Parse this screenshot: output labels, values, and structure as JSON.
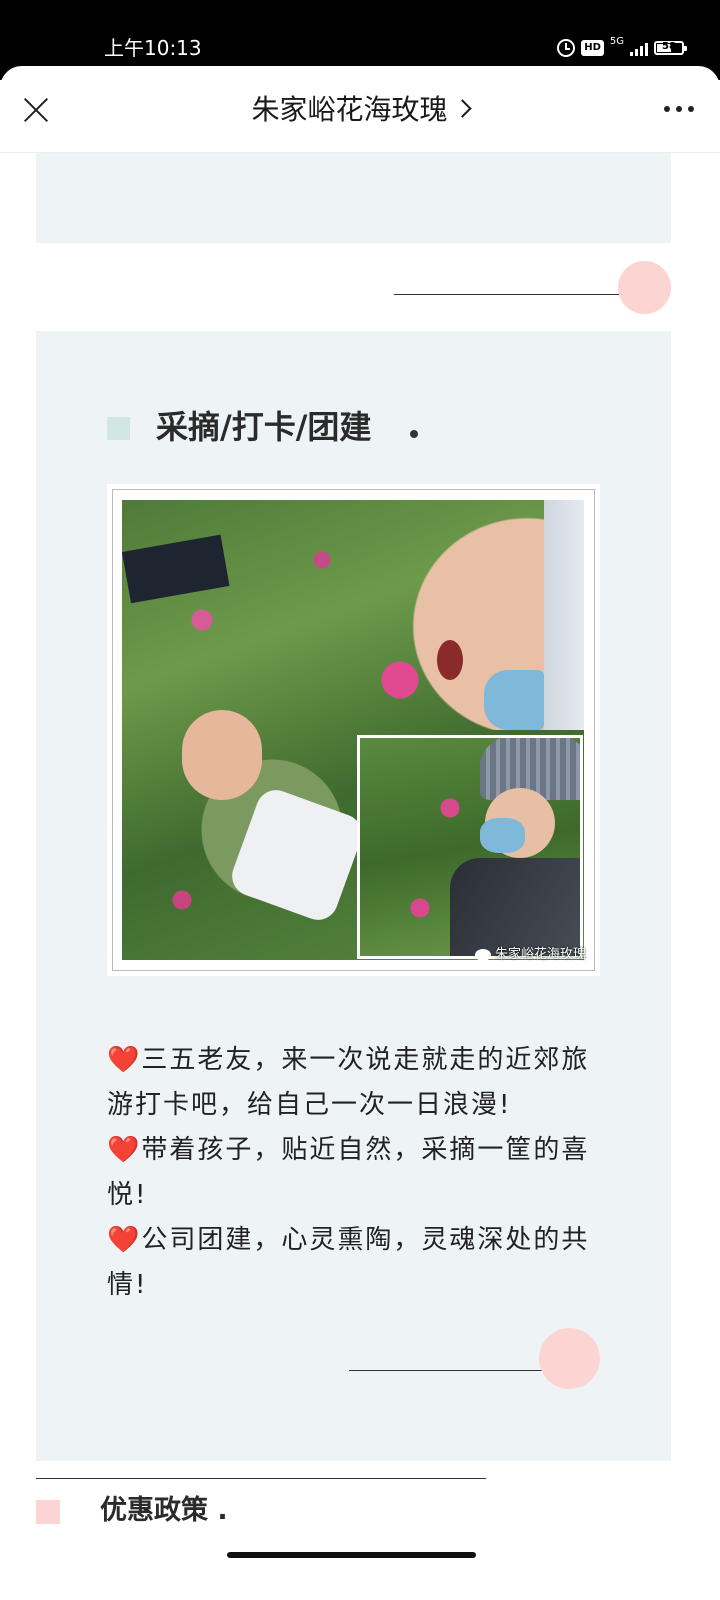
{
  "status_bar": {
    "time": "上午10:13",
    "hd_label": "HD",
    "network_label": "5G",
    "battery_level": "58"
  },
  "navbar": {
    "title": "朱家峪花海玫瑰"
  },
  "section": {
    "title": "采摘/打卡/团建",
    "photo_watermark": "朱家峪花海玫瑰",
    "paragraphs": [
      {
        "icon": "heart-icon",
        "heart": "❤️",
        "text": "三五老友，来一次说走就走的近郊旅游打卡吧，给自己一次一日浪漫!"
      },
      {
        "icon": "heart-icon",
        "heart": "❤️",
        "text": "带着孩子，贴近自然，采摘一筐的喜悦!"
      },
      {
        "icon": "heart-icon",
        "heart": "❤️",
        "text": "公司团建，心灵熏陶，灵魂深处的共情!"
      }
    ]
  },
  "next_section": {
    "title": "优惠政策 ."
  },
  "colors": {
    "panel_bg": "#eef4f5",
    "accent_pink": "#fcd5d2",
    "accent_mint": "#d2e7e3",
    "heart_red": "#e3151a"
  }
}
